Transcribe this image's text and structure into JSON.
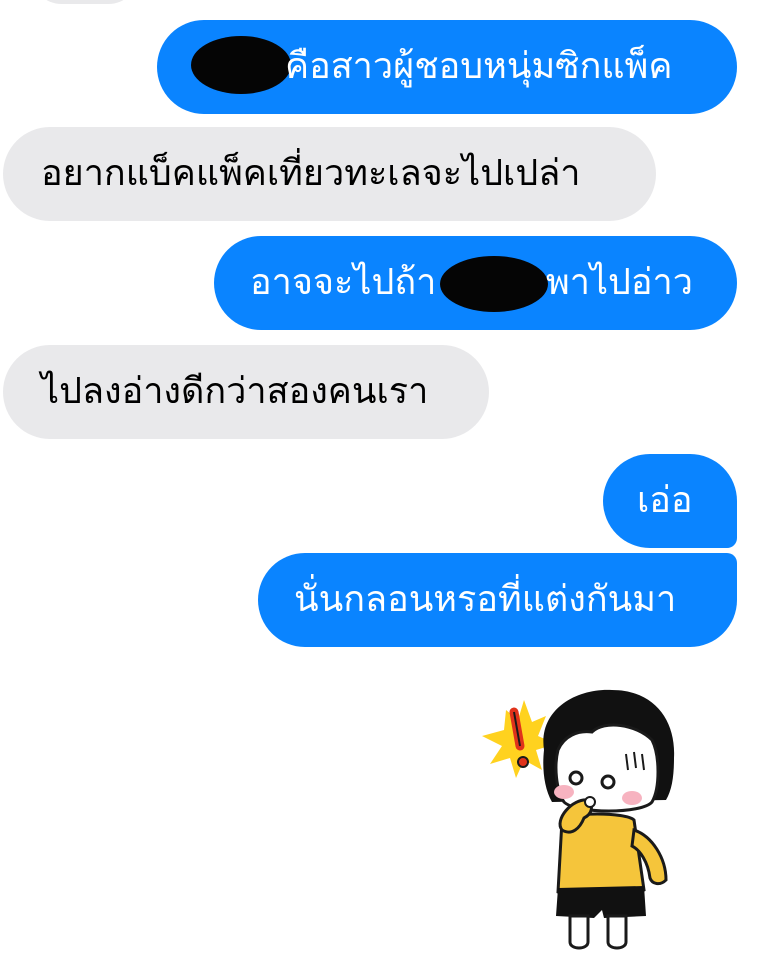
{
  "conversation": {
    "messages": [
      {
        "side": "outgoing",
        "text": "คือสาวผู้ชอบหนุ่มซิกแพ็ค",
        "redacted_prefix": true
      },
      {
        "side": "incoming",
        "text": "อยากแบ็คแพ็คเที่ยวทะเลจะไปเปล่า"
      },
      {
        "side": "outgoing",
        "text_before": "อาจจะไปถ้า",
        "text_after": "พาไปอ่าว",
        "redacted_middle": true
      },
      {
        "side": "incoming",
        "text": "ไปลงอ่างดีกว่าสองคนเรา"
      },
      {
        "side": "outgoing",
        "text": "เอ่อ"
      },
      {
        "side": "outgoing",
        "text": "นั่นกลอนหรอที่แต่งกันมา"
      }
    ],
    "sticker": {
      "icon": "surprised-girl-sticker-icon",
      "alert_icon": "exclamation-icon"
    }
  },
  "colors": {
    "outgoing_bubble": "#0a84ff",
    "incoming_bubble": "#e9e9eb",
    "outgoing_text": "#ffffff",
    "incoming_text": "#000000"
  }
}
